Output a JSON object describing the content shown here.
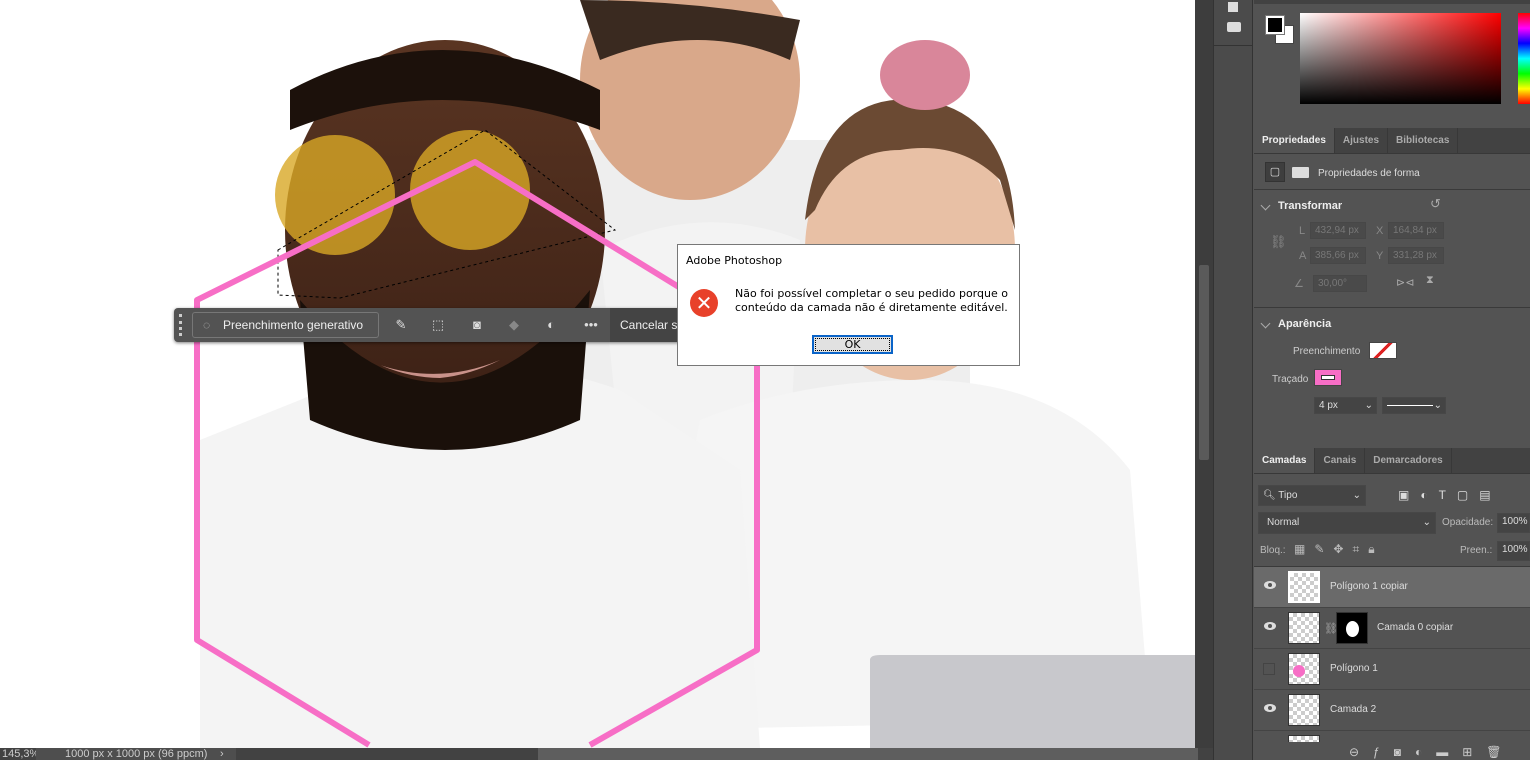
{
  "status": {
    "zoom": "145,3%",
    "doc_size": "1000 px x 1000 px (96 ppcm)"
  },
  "context_bar": {
    "generative_fill": "Preenchimento generativo",
    "cancel": "Cancelar s"
  },
  "dialog": {
    "title": "Adobe Photoshop",
    "message_line1": "Não foi possível completar o seu pedido porque o",
    "message_line2": "conteúdo da camada não é diretamente editável.",
    "ok": "OK"
  },
  "properties": {
    "tabs": [
      "Propriedades",
      "Ajustes",
      "Bibliotecas"
    ],
    "subtitle": "Propriedades de forma",
    "transform": {
      "title": "Transformar",
      "L_label": "L",
      "L": "432,94 px",
      "X_label": "X",
      "X": "164,84 px",
      "A_label": "A",
      "A": "385,66 px",
      "Y_label": "Y",
      "Y": "331,28 px",
      "angle": "30,00°"
    },
    "appearance": {
      "title": "Aparência",
      "fill_label": "Preenchimento",
      "stroke_label": "Traçado",
      "stroke_width": "4 px",
      "stroke_color": "#f76ec6"
    }
  },
  "layers": {
    "tabs": [
      "Camadas",
      "Canais",
      "Demarcadores"
    ],
    "filter": "Tipo",
    "blend": "Normal",
    "opacity_label": "Opacidade:",
    "opacity": "100%",
    "lock_label": "Bloq.:",
    "fill_label": "Preen.:",
    "fill": "100%",
    "items": [
      {
        "name": "Polígono 1 copiar",
        "visible": true,
        "selected": true
      },
      {
        "name": "Camada 0 copiar",
        "visible": true
      },
      {
        "name": "Polígono 1",
        "visible": false
      },
      {
        "name": "Camada 2",
        "visible": true
      }
    ]
  },
  "colors": {
    "accent_pink": "#f76ec6",
    "foreground": "#000000",
    "background": "#ffffff"
  }
}
